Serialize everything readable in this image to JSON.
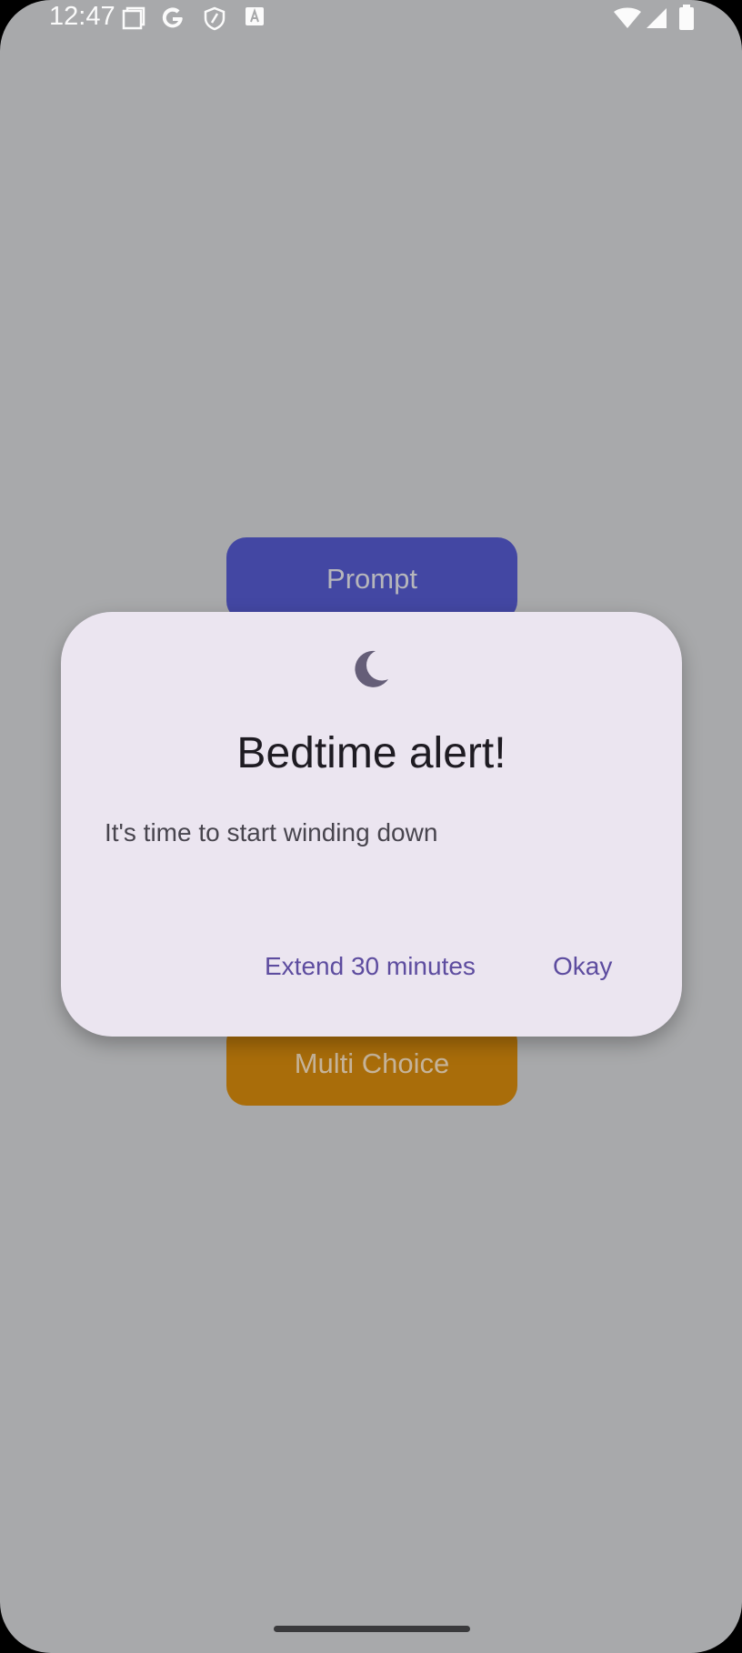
{
  "status_bar": {
    "time": "12:47",
    "left_icons": [
      "screenshot-icon",
      "google-icon",
      "shield-icon",
      "font-icon"
    ],
    "right_icons": [
      "wifi-icon",
      "signal-icon",
      "battery-icon"
    ]
  },
  "background": {
    "prompt_label": "Prompt",
    "multi_choice_label": "Multi Choice"
  },
  "dialog": {
    "icon": "moon-icon",
    "title": "Bedtime alert!",
    "message": "It's time to start winding down",
    "actions": {
      "extend": "Extend 30 minutes",
      "okay": "Okay"
    }
  },
  "colors": {
    "scrim": "#a8a9ab",
    "dialog_surface": "#ebe5f0",
    "accent": "#5d4c9f",
    "prompt_button": "#4347a3",
    "multi_choice_button": "#a96d0a"
  }
}
